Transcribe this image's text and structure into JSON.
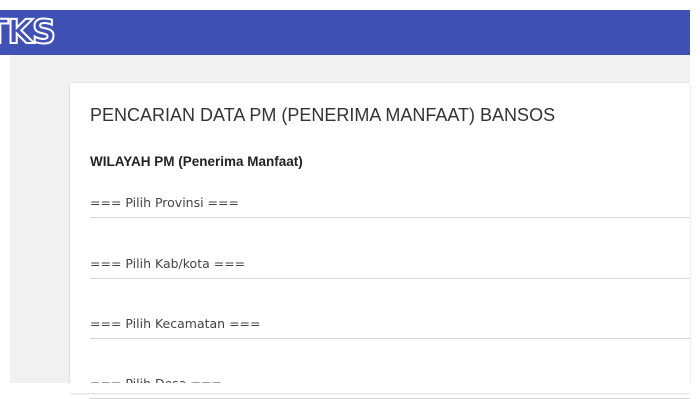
{
  "header": {
    "logo_text": "TKS",
    "accent_color": "#3f51b5"
  },
  "card": {
    "title": "PENCARIAN DATA PM (PENERIMA MANFAAT) BANSOS",
    "section_label": "WILAYAH PM (Penerima Manfaat)",
    "selects": {
      "provinsi": "=== Pilih Provinsi ===",
      "kabkota": "=== Pilih Kab/kota ===",
      "kecamatan": "=== Pilih Kecamatan ===",
      "desa": "=== Pilih Desa ==="
    }
  }
}
